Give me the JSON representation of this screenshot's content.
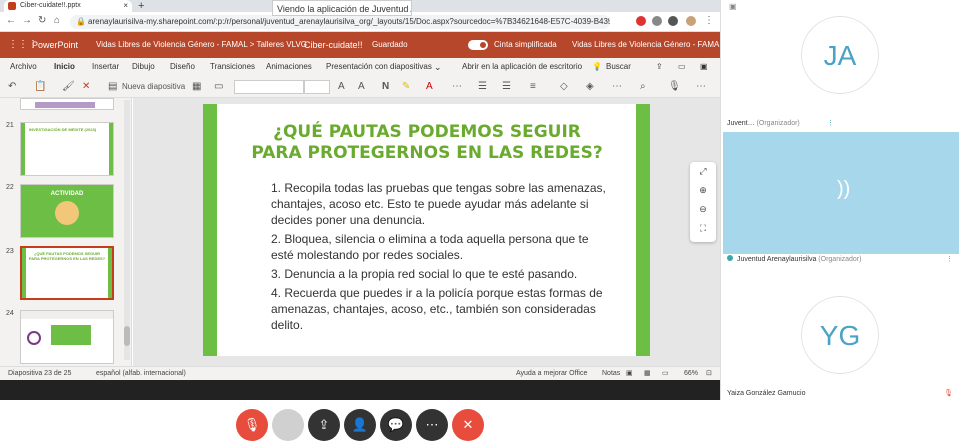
{
  "browser": {
    "tab_title": "Ciber-cuidate!!.pptx",
    "share_banner": "Viendo la aplicación de Juventud Aren…",
    "url": "arenaylaurisilva-my.sharepoint.com/:p:/r/personal/juventud_arenaylaurisilva_org/_layouts/15/Doc.aspx?sourcedoc=%7B34621648-E57C-4039-B435-4A64B91…"
  },
  "app": {
    "name": "PowerPoint",
    "breadcrumb": "Vidas Libres de Violencia Género - FAMAL > Talleres VLVG",
    "file_name": "Ciber-cuidate!!",
    "save_state": "Guardado",
    "simplified_label": "Cinta simplificada",
    "org_label": "Vidas Libres de Violencia Género - FAMAL"
  },
  "menu": [
    "Archivo",
    "Inicio",
    "Insertar",
    "Dibujo",
    "Diseño",
    "Transiciones",
    "Animaciones",
    "Presentación con diapositivas"
  ],
  "menu_extra": {
    "open_desktop": "Abrir en la aplicación de escritorio",
    "search": "Buscar"
  },
  "toolbar": {
    "new_slide": "Nueva diapositiva"
  },
  "thumbnails": [
    {
      "num": "21",
      "title": "INVESTIGACIÓN DE MEDITE (2023)"
    },
    {
      "num": "22",
      "title": "ACTIVIDAD"
    },
    {
      "num": "23",
      "title": "¿QUÉ PAUTAS PODEMOS SEGUIR PARA PROTEGERNOS EN LAS REDES?"
    },
    {
      "num": "24",
      "title": ""
    }
  ],
  "slide": {
    "title_line1": "¿QUÉ PAUTAS PODEMOS SEGUIR",
    "title_line2": "PARA PROTEGERNOS EN LAS REDES?",
    "items": [
      "1. Recopila todas las pruebas que tengas sobre las amenazas, chantajes, acoso etc. Esto te puede ayudar más adelante si decides poner una denuncia.",
      "2. Bloquea, silencia o elimina a toda aquella persona que te esté molestando por redes sociales.",
      "3. Denuncia a la propia red social lo que te esté pasando.",
      "4. Recuerda que puedes ir a la policía porque estas formas de amenazas, chantajes, acoso, etc., también son consideradas delito."
    ]
  },
  "status": {
    "slide_pos": "Diapositiva 23 de 25",
    "language": "español (alfab. internacional)",
    "help": "Ayuda a mejorar Office",
    "notes": "Notas",
    "zoom": "66%"
  },
  "participants": [
    {
      "initials": "JA",
      "name": "Juvent…",
      "role": "(Organizador)"
    },
    {
      "initials": "",
      "name": "Juventud Arenaylaurisilva",
      "role": "(Organizador)"
    },
    {
      "initials": "YG",
      "name": "Yaiza González Gamucio",
      "role": ""
    }
  ],
  "colors": {
    "ppt_red": "#b7472a",
    "slide_green": "#6dbe45",
    "end_call": "#e74c3c"
  }
}
